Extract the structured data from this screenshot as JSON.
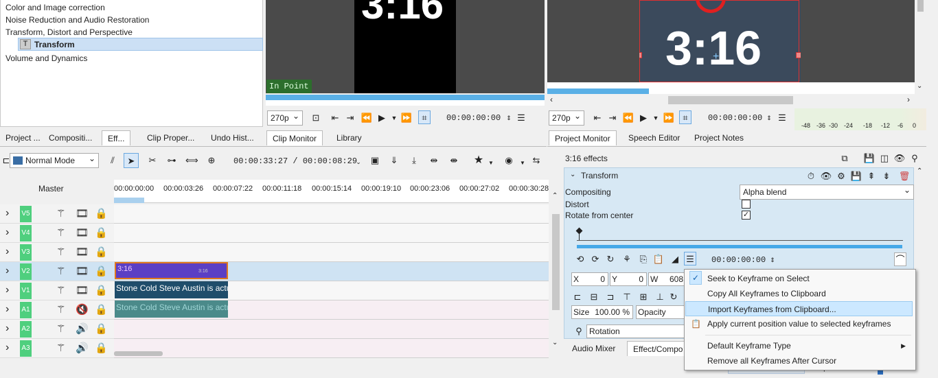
{
  "effects_tree": {
    "items": [
      "Color and Image correction",
      "Noise Reduction and Audio Restoration",
      "Transform, Distort and Perspective",
      "Transform",
      "Volume and Dynamics"
    ]
  },
  "clip_monitor": {
    "big_text": "3:16",
    "in_point": "In Point",
    "zoom": "270p",
    "timecode": "00:00:00:00",
    "progress": 0.0
  },
  "project_monitor": {
    "big_text": "3:16",
    "zoom": "270p",
    "timecode": "00:00:00:00",
    "progress": 0.27,
    "meter_labels": [
      "-48",
      "-36",
      "-30",
      "-24",
      "-18",
      "-12",
      "-6",
      "0"
    ]
  },
  "left_tabs": [
    "Project ...",
    "Compositi...",
    "Eff...",
    "Clip Proper...",
    "Undo Hist...",
    "Clip Monitor",
    "Library"
  ],
  "right_tabs": [
    "Project Monitor",
    "Speech Editor",
    "Project Notes"
  ],
  "timeline_toolbar": {
    "mode": "Normal Mode",
    "timecode": "00:00:33:27 / 00:00:08:29"
  },
  "timeline": {
    "master_label": "Master",
    "ruler": [
      "00:00:00:00",
      "00:00:03:26",
      "00:00:07:22",
      "00:00:11:18",
      "00:00:15:14",
      "00:00:19:10",
      "00:00:23:06",
      "00:00:27:02",
      "00:00:30:28"
    ],
    "tracks": [
      {
        "name": "V5",
        "type": "video"
      },
      {
        "name": "V4",
        "type": "video"
      },
      {
        "name": "V3",
        "type": "video"
      },
      {
        "name": "V2",
        "type": "video",
        "selected": true
      },
      {
        "name": "V1",
        "type": "video"
      },
      {
        "name": "A1",
        "type": "audio",
        "muted": true
      },
      {
        "name": "A2",
        "type": "audio"
      },
      {
        "name": "A3",
        "type": "audio"
      }
    ],
    "clip_v2": "3:16",
    "clip_v2_thumb": "3:16",
    "clip_v1": "Stone Cold Steve Austin is actu",
    "clip_a1": "Stone Cold Steve Austin is actu"
  },
  "effect_stack": {
    "title": "3:16 effects",
    "effect_name": "Transform",
    "compositing_label": "Compositing",
    "compositing_value": "Alpha blend",
    "distort_label": "Distort",
    "distort_checked": false,
    "rotate_label": "Rotate from center",
    "rotate_checked": true,
    "kf_timecode": "00:00:00:00",
    "x_label": "X",
    "x_value": "0",
    "y_label": "Y",
    "y_value": "0",
    "w_label": "W",
    "w_value": "608",
    "size_label": "Size",
    "size_value": "100.00 %",
    "opacity_label": "Opacity",
    "rotation_label": "Rotation"
  },
  "bottom_tabs": [
    "Audio Mixer",
    "Effect/Compo"
  ],
  "context_menu": {
    "items": [
      {
        "label": "Seek to Keyframe on Select",
        "checked": true
      },
      {
        "label": "Copy All Keyframes to Clipboard"
      },
      {
        "label": "Import Keyframes from Clipboard...",
        "highlighted": true
      },
      {
        "label": "Apply current position value to selected keyframes",
        "icon": "clipboard"
      },
      {
        "label": "Default Keyframe Type",
        "submenu": true
      },
      {
        "label": "Remove all Keyframes After Cursor"
      }
    ]
  },
  "colors": {
    "accent": "#cce0f5",
    "track_green": "#4fcf7e",
    "clip_purple": "#5b3fc4",
    "clip_teal": "#2f6f7f",
    "menu_highlight": "#cce8ff"
  }
}
